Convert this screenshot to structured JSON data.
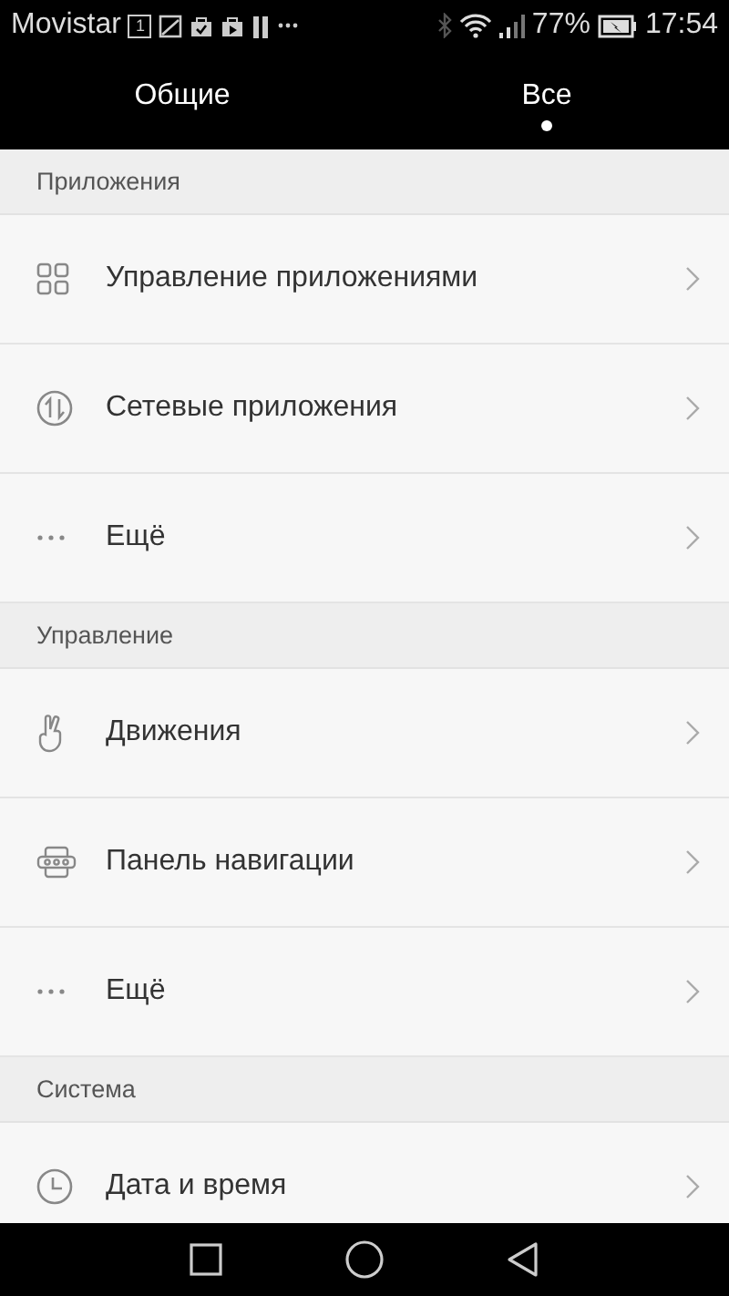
{
  "status_bar": {
    "carrier": "Movistar",
    "calendar_day": "1",
    "battery_percent": "77%",
    "time": "17:54"
  },
  "tabs": [
    {
      "label": "Общие",
      "selected": false
    },
    {
      "label": "Все",
      "selected": true
    }
  ],
  "sections": [
    {
      "title": "Приложения",
      "items": [
        {
          "kind": "grid",
          "label": "Управление приложениями"
        },
        {
          "kind": "network",
          "label": "Сетевые приложения"
        },
        {
          "kind": "more",
          "label": "Ещё"
        }
      ]
    },
    {
      "title": "Управление",
      "items": [
        {
          "kind": "gesture",
          "label": "Движения"
        },
        {
          "kind": "navbar",
          "label": "Панель навигации"
        },
        {
          "kind": "more",
          "label": "Ещё"
        }
      ]
    },
    {
      "title": "Система",
      "items": [
        {
          "kind": "clock",
          "label": "Дата и время"
        }
      ]
    }
  ]
}
